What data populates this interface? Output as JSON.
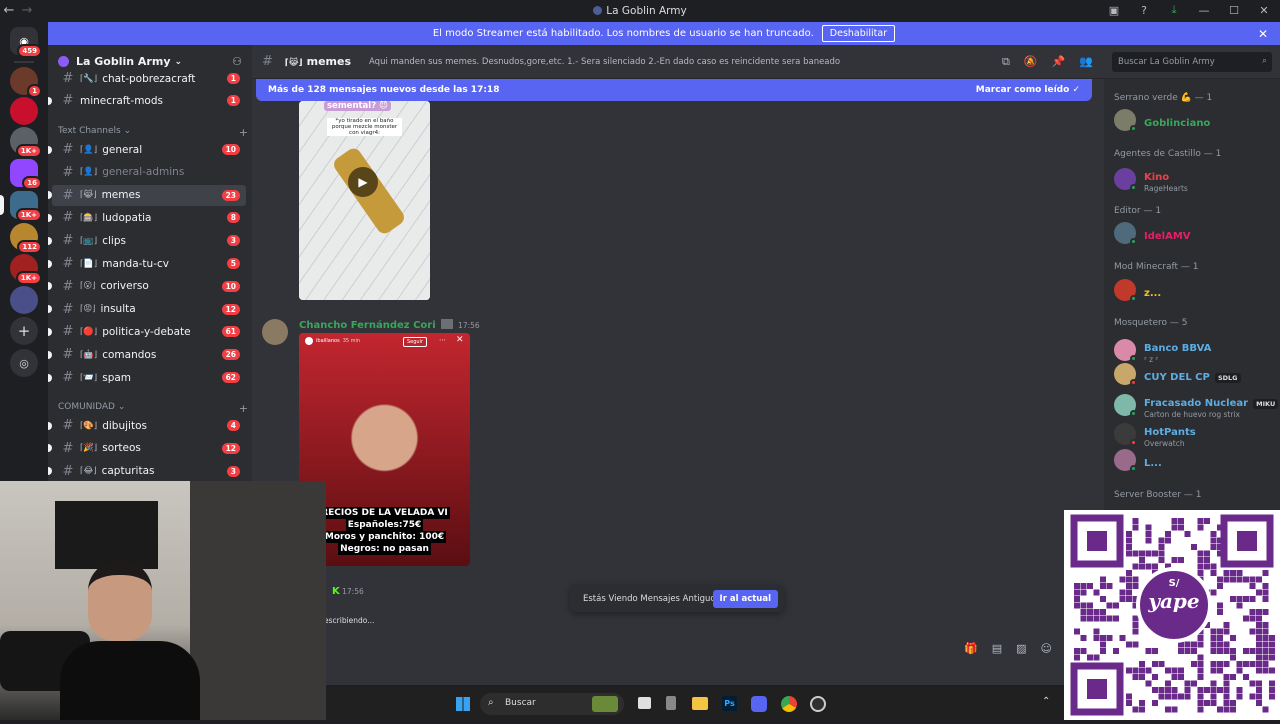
{
  "window": {
    "title": "La Goblin Army"
  },
  "banner": {
    "message": "El modo Streamer está habilitado. Los nombres de usuario se han truncado.",
    "button": "Deshabilitar"
  },
  "rail": {
    "badges": [
      "459",
      "1",
      "1K+",
      "16",
      "1K+",
      "112",
      "1K+"
    ]
  },
  "server": {
    "name": "La Goblin Army"
  },
  "sidebar": {
    "top_channels": [
      {
        "emoji": "⌈🔧⌋",
        "name": "chat-pobrezacraft",
        "badge": "1"
      },
      {
        "emoji": "",
        "name": "minecraft-mods",
        "badge": "1"
      }
    ],
    "text_category": "Text Channels",
    "text_channels": [
      {
        "emoji": "⌈👤⌋",
        "name": "general",
        "badge": "10",
        "muted": false
      },
      {
        "emoji": "⌈👤⌋",
        "name": "general-admins",
        "badge": "",
        "muted": true
      },
      {
        "emoji": "⌈😹⌋",
        "name": "memes",
        "badge": "23",
        "muted": false
      },
      {
        "emoji": "⌈🎰⌋",
        "name": "ludopatia",
        "badge": "8",
        "muted": false
      },
      {
        "emoji": "⌈📺⌋",
        "name": "clips",
        "badge": "3",
        "muted": false
      },
      {
        "emoji": "⌈📄⌋",
        "name": "manda-tu-cv",
        "badge": "5",
        "muted": false
      },
      {
        "emoji": "⌈😮⌋",
        "name": "coriverso",
        "badge": "10",
        "muted": false
      },
      {
        "emoji": "⌈😡⌋",
        "name": "insulta",
        "badge": "12",
        "muted": false
      },
      {
        "emoji": "⌈🔴⌋",
        "name": "politica-y-debate",
        "badge": "61",
        "muted": false
      },
      {
        "emoji": "⌈🤖⌋",
        "name": "comandos",
        "badge": "26",
        "muted": false
      },
      {
        "emoji": "⌈📨⌋",
        "name": "spam",
        "badge": "62",
        "muted": false
      }
    ],
    "community_category": "COMUNIDAD",
    "community_channels": [
      {
        "emoji": "⌈🎨⌋",
        "name": "dibujitos",
        "badge": "4"
      },
      {
        "emoji": "⌈🎉⌋",
        "name": "sorteos",
        "badge": "12"
      },
      {
        "emoji": "⌈😂⌋",
        "name": "capturitas",
        "badge": "3"
      }
    ]
  },
  "header": {
    "channel": "memes",
    "emoji": "⌈😹⌋",
    "topic": "Aqui manden sus memes. Desnudos,gore,etc. 1.- Sera silenciado 2.-En dado caso es reincidente sera baneado",
    "search_placeholder": "Buscar La Goblin Army"
  },
  "newbar": {
    "text": "Más de 128 mensajes nuevos desde las 17:18",
    "action": "Marcar como leído"
  },
  "messages": {
    "first_image_caption": "*yo tirado en el baño porque mezcle monster con viagr4:",
    "first_image_top": "semental? 😈",
    "author": "Chancho Fernández Cori",
    "time": "17:56",
    "story_user": "ibaillanos",
    "story_time": "35 min",
    "story_follow": "Seguir",
    "story_lines": [
      "RECIOS DE LA VELADA VI",
      "Españoles:75€",
      "Moros y panchito: 100€",
      "Negros: no pasan"
    ],
    "next_time": "17:56",
    "typing": "escribiendo..."
  },
  "jump": {
    "text": "Estás Viendo Mensajes Antiguos",
    "button": "Ir al actual"
  },
  "members": {
    "groups": [
      {
        "role": "Serrano verde 💪 — 1",
        "members": [
          {
            "name": "Goblinciano",
            "sub": "",
            "color": "#3ba55c"
          }
        ]
      },
      {
        "role": "Agentes de Castillo — 1",
        "members": [
          {
            "name": "Kino",
            "sub": "RageHearts",
            "color": "#ed4245"
          }
        ]
      },
      {
        "role": "Editor — 1",
        "members": [
          {
            "name": "IdelAMV",
            "sub": "",
            "color": "#e91e63"
          }
        ]
      },
      {
        "role": "Mod Minecraft — 1",
        "members": [
          {
            "name": "z...",
            "sub": "",
            "color": "#f1c40f"
          }
        ]
      },
      {
        "role": "Mosquetero — 5",
        "members": [
          {
            "name": "Banco BBVA",
            "sub": "ᶻ z ᶻ",
            "color": "#5dade2"
          },
          {
            "name": "CUY DEL CP",
            "sub": "",
            "tag": "SDLG",
            "color": "#5dade2"
          },
          {
            "name": "Fracasado Nuclear",
            "sub": "Carton de huevo rog strix",
            "tag": "MIKU",
            "color": "#5dade2"
          },
          {
            "name": "HotPants",
            "sub": "Overwatch",
            "color": "#5dade2"
          },
          {
            "name": "L...",
            "sub": "",
            "color": "#5dade2"
          }
        ]
      },
      {
        "role": "Server Booster — 1",
        "members": []
      }
    ]
  },
  "taskbar": {
    "search_placeholder": "Buscar"
  },
  "qr": {
    "brand": "yape",
    "symbol": "S/"
  }
}
